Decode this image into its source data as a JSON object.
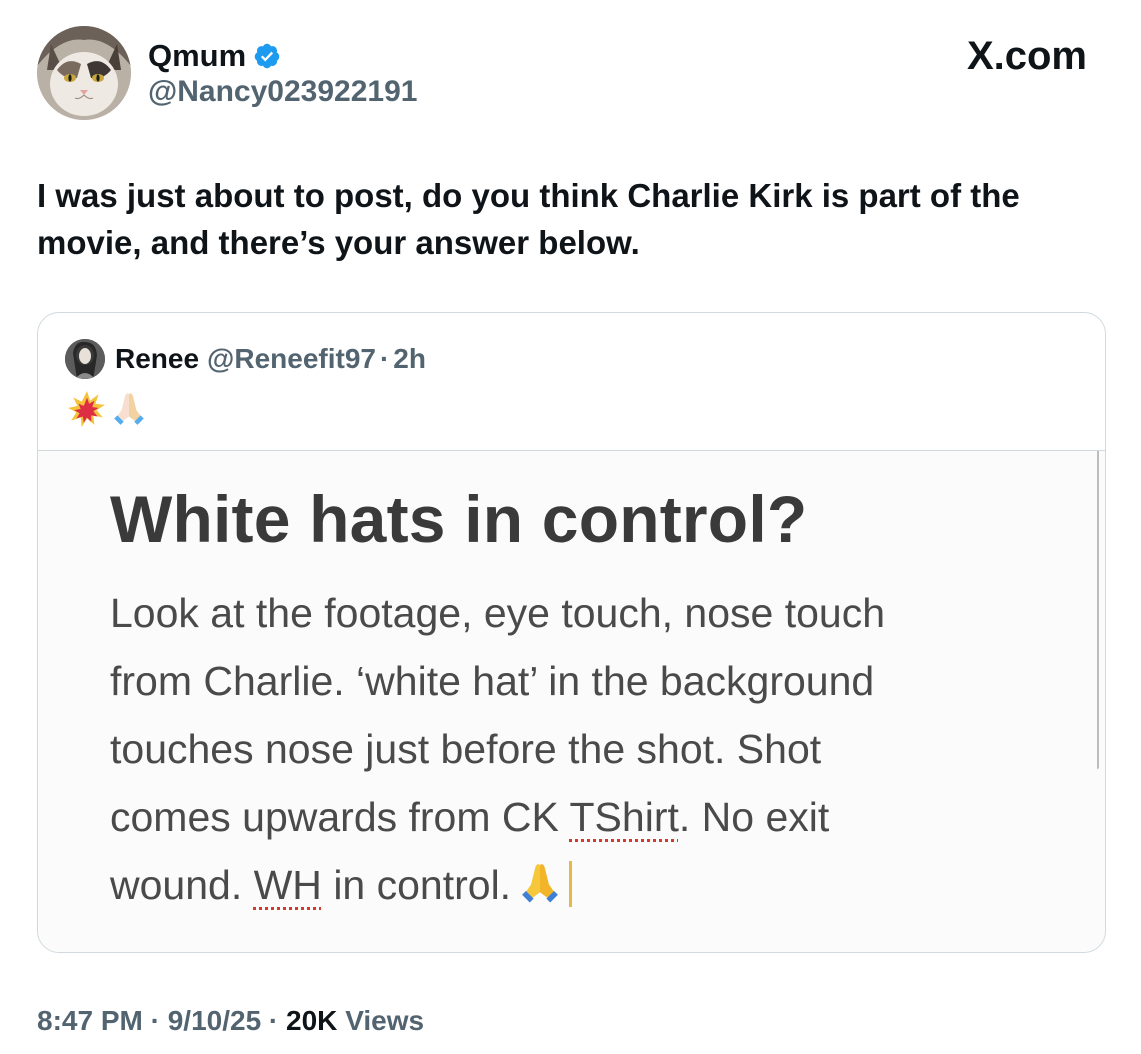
{
  "author": {
    "display_name": "Qmum",
    "handle": "@Nancy023922191",
    "verified": true
  },
  "brand": {
    "label": "X.com"
  },
  "tweet": {
    "text": "I was just about to post, do you think Charlie Kirk is part of the movie, and there’s your answer below."
  },
  "quote": {
    "display_name": "Renee",
    "handle": "@Reneefit97",
    "separator": "·",
    "time": "2h",
    "emojis": [
      "collision-emoji",
      "folded-hands-emoji"
    ],
    "image": {
      "title": "White hats in control?",
      "lines": [
        [
          "Look at the footage, eye touch, nose touch",
          "",
          ""
        ],
        [
          "from Charlie. ‘white hat’ in the background",
          "",
          ""
        ],
        [
          "touches nose just before the shot. Shot",
          "",
          ""
        ],
        [
          "comes upwards from CK ",
          "TShirt",
          ". No exit"
        ],
        [
          "wound. ",
          "WH",
          " in control."
        ]
      ]
    }
  },
  "footer": {
    "time": "8:47 PM",
    "date": "9/10/25",
    "separator": "·",
    "views_count": "20K",
    "views_label": "Views"
  },
  "colors": {
    "text_primary": "#0f1419",
    "text_secondary": "#536471",
    "border": "#cfd9de",
    "verified_blue": "#1d9bf0"
  }
}
